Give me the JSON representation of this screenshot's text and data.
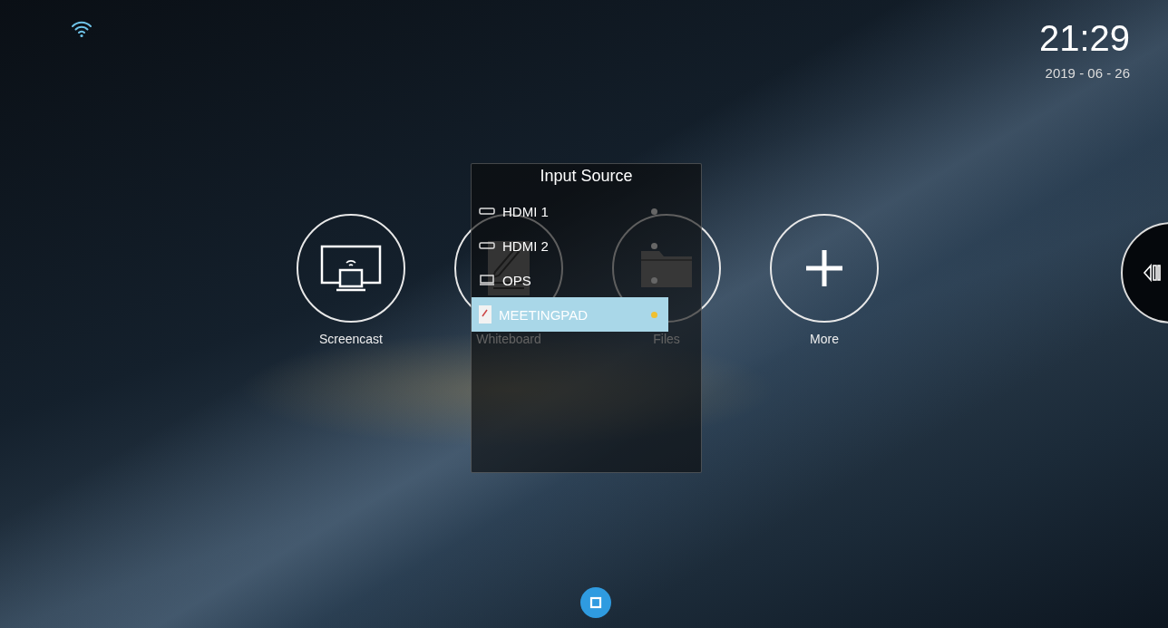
{
  "status_bar": {
    "time": "21:29",
    "date": "2019 - 06 - 26"
  },
  "apps": [
    {
      "label": "Screencast",
      "kind": "screencast"
    },
    {
      "label": "Whiteboard",
      "kind": "whiteboard"
    },
    {
      "label": "Files",
      "kind": "files"
    },
    {
      "label": "More",
      "kind": "more"
    }
  ],
  "input_source": {
    "title": "Input Source",
    "items": [
      {
        "label": "HDMI 1",
        "kind": "hdmi",
        "selected": false
      },
      {
        "label": "HDMI 2",
        "kind": "hdmi",
        "selected": false
      },
      {
        "label": "OPS",
        "kind": "ops",
        "selected": false
      },
      {
        "label": "MEETINGPAD",
        "kind": "meetingpad",
        "selected": true
      }
    ]
  }
}
